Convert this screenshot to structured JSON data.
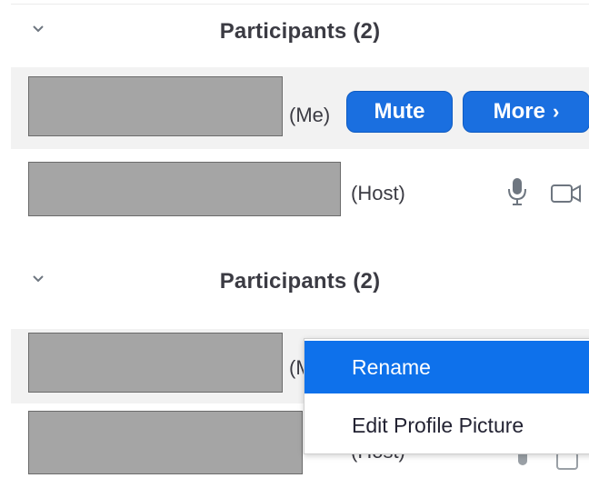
{
  "top_panel": {
    "title": "Participants (2)",
    "me_row": {
      "tag": "(Me)",
      "mute_label": "Mute",
      "more_label": "More",
      "more_arrow": "›"
    },
    "host_row": {
      "tag": "(Host)"
    }
  },
  "bottom_panel": {
    "title": "Participants (2)",
    "me_row": {
      "tag": "(M"
    },
    "host_row": {
      "tag": "(Host)"
    }
  },
  "context_menu": {
    "items": [
      {
        "label": "Rename"
      },
      {
        "label": "Edit Profile Picture"
      }
    ]
  },
  "colors": {
    "accent": "#0e71eb",
    "button": "#1a6fe0",
    "redaction": "#a5a5a5"
  },
  "icons": [
    "chevron-down-icon",
    "microphone-icon",
    "video-camera-icon"
  ]
}
